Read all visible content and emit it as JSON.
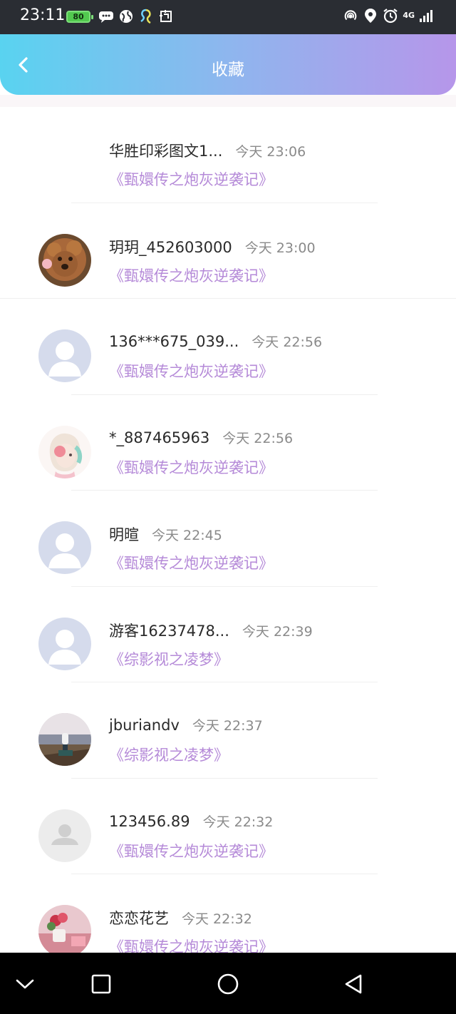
{
  "status_bar": {
    "time": "23:11",
    "battery": "80",
    "network": "4G",
    "icons_left": [
      "chat-icon",
      "globe-icon",
      "app-icon",
      "screenshot-icon"
    ],
    "icons_right": [
      "hotspot-icon",
      "location-icon",
      "alarm-icon",
      "signal-icon"
    ]
  },
  "header": {
    "title": "收藏",
    "back_icon": "chevron-left-icon",
    "gradient": [
      "#59d3f0",
      "#b696ea"
    ]
  },
  "colors": {
    "book_title": "#b58ad8",
    "name": "#2a2a2a",
    "time": "#8a8a8a"
  },
  "items": [
    {
      "name": "华胜印彩图文1...",
      "time": "今天 23:06",
      "book": "《甄嬛传之炮灰逆袭记》",
      "avatar": "none"
    },
    {
      "name": "玥玥_452603000",
      "time": "今天 23:00",
      "book": "《甄嬛传之炮灰逆袭记》",
      "avatar": "dog-photo"
    },
    {
      "name": "136***675_039...",
      "time": "今天 22:56",
      "book": "《甄嬛传之炮灰逆袭记》",
      "avatar": "default-user"
    },
    {
      "name": "*_887465963",
      "time": "今天 22:56",
      "book": "《甄嬛传之炮灰逆袭记》",
      "avatar": "girl-illustration"
    },
    {
      "name": "明暄",
      "time": "今天 22:45",
      "book": "《甄嬛传之炮灰逆袭记》",
      "avatar": "default-user"
    },
    {
      "name": "游客16237478...",
      "time": "今天 22:39",
      "book": "《综影视之凌梦》",
      "avatar": "default-user"
    },
    {
      "name": "jburiandv",
      "time": "今天 22:37",
      "book": "《综影视之凌梦》",
      "avatar": "landscape-photo"
    },
    {
      "name": "123456.89",
      "time": "今天 22:32",
      "book": "《甄嬛传之炮灰逆袭记》",
      "avatar": "grey-user"
    },
    {
      "name": "恋恋花艺",
      "time": "今天 22:32",
      "book": "《甄嬛传之炮灰逆袭记》",
      "avatar": "flower-photo"
    }
  ],
  "nav_bar": {
    "buttons": [
      "collapse-icon",
      "recents-icon",
      "home-icon",
      "back-icon"
    ]
  }
}
